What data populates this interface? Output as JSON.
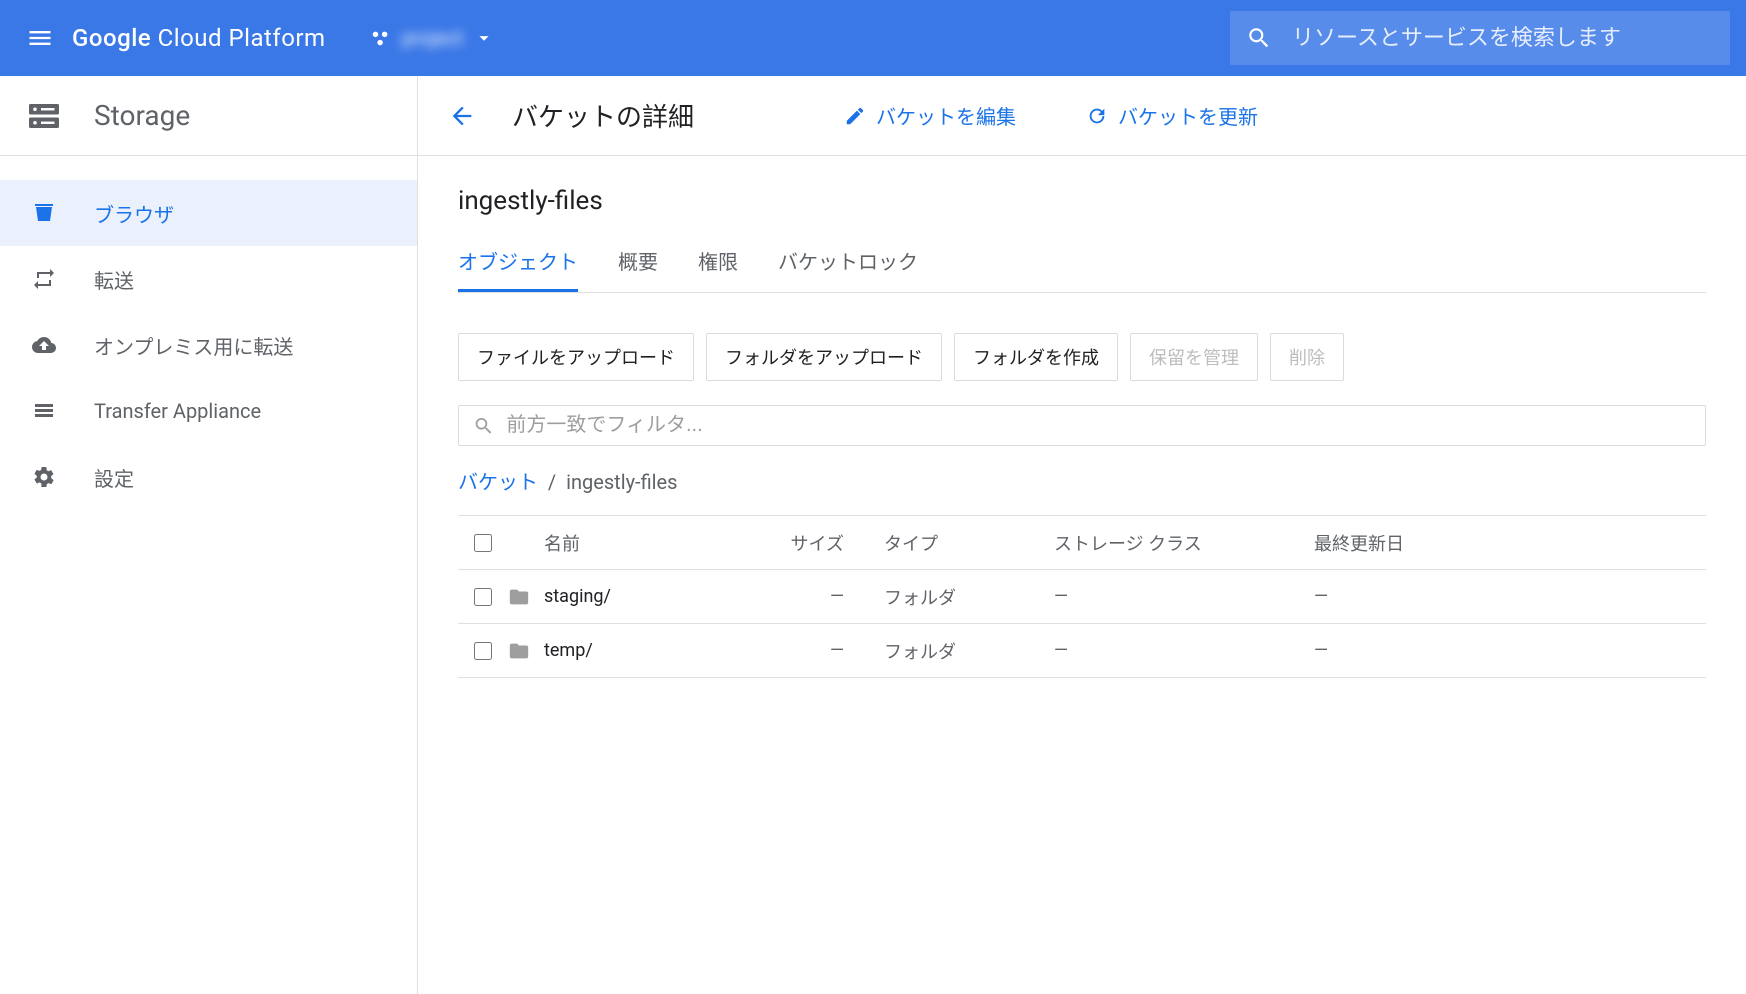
{
  "topbar": {
    "product": "Google Cloud Platform",
    "project_name": "project",
    "search_placeholder": "リソースとサービスを検索します"
  },
  "sidebar": {
    "service_title": "Storage",
    "items": [
      {
        "label": "ブラウザ",
        "icon": "bucket-icon",
        "active": true
      },
      {
        "label": "転送",
        "icon": "transfer-icon",
        "active": false
      },
      {
        "label": "オンプレミス用に転送",
        "icon": "cloud-upload-icon",
        "active": false
      },
      {
        "label": "Transfer Appliance",
        "icon": "appliance-icon",
        "active": false
      },
      {
        "label": "設定",
        "icon": "gear-icon",
        "active": false
      }
    ]
  },
  "page": {
    "title": "バケットの詳細",
    "edit_label": "バケットを編集",
    "refresh_label": "バケットを更新",
    "bucket_name": "ingestly-files",
    "tabs": [
      {
        "label": "オブジェクト",
        "active": true
      },
      {
        "label": "概要",
        "active": false
      },
      {
        "label": "権限",
        "active": false
      },
      {
        "label": "バケットロック",
        "active": false
      }
    ],
    "toolbar": {
      "upload_file": "ファイルをアップロード",
      "upload_folder": "フォルダをアップロード",
      "create_folder": "フォルダを作成",
      "manage_holds": "保留を管理",
      "delete": "削除"
    },
    "filter_placeholder": "前方一致でフィルタ...",
    "breadcrumb": {
      "root": "バケット",
      "current": "ingestly-files"
    },
    "table": {
      "headers": {
        "name": "名前",
        "size": "サイズ",
        "type": "タイプ",
        "storage_class": "ストレージ クラス",
        "last_modified": "最終更新日"
      },
      "rows": [
        {
          "name": "staging/",
          "size": "—",
          "type": "フォルダ",
          "storage_class": "—",
          "last_modified": "—"
        },
        {
          "name": "temp/",
          "size": "—",
          "type": "フォルダ",
          "storage_class": "—",
          "last_modified": "—"
        }
      ]
    }
  }
}
